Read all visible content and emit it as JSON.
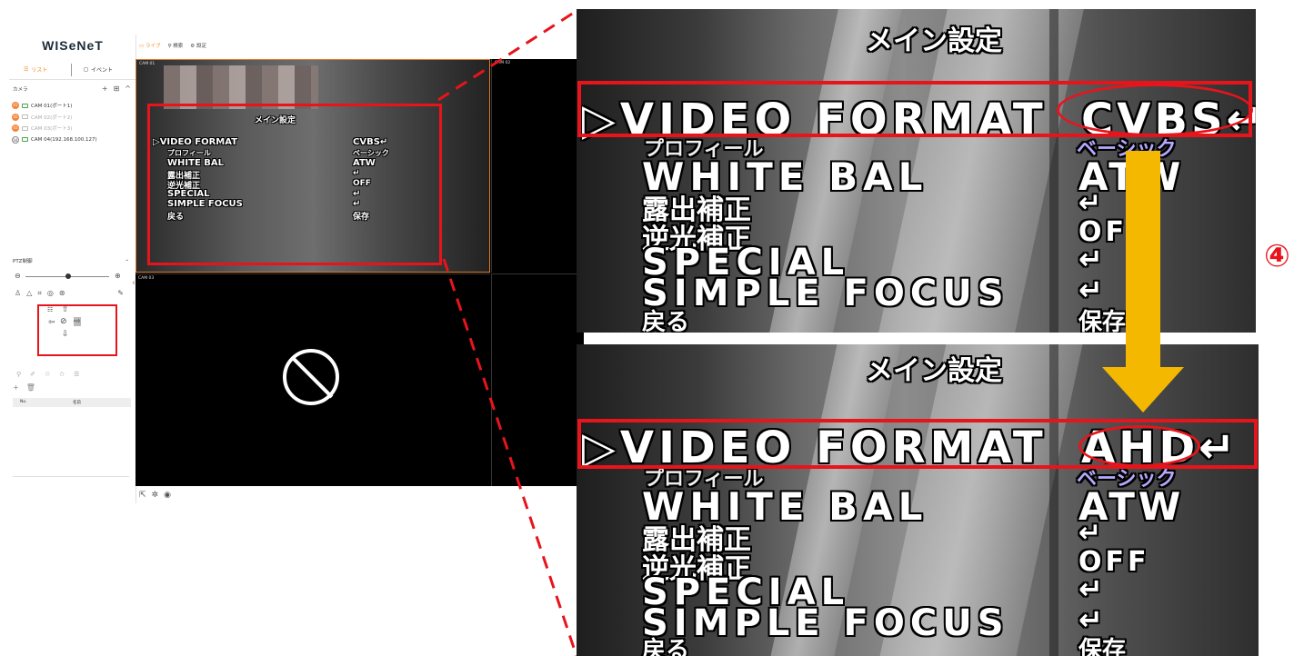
{
  "app": {
    "logo": "WISeNeT",
    "tabs": {
      "list": "リスト",
      "event": "イベント"
    },
    "topbar": {
      "live": "ライブ",
      "search": "検索",
      "settings": "設定"
    },
    "camera_section": {
      "title": "カメラ"
    },
    "cameras": [
      {
        "badge": "01",
        "label": "CAM 01(ポート1)",
        "active": true
      },
      {
        "badge": "02",
        "label": "CAM 02(ポート2)",
        "active": false
      },
      {
        "badge": "03",
        "label": "CAM 03(ポート3)",
        "active": true
      },
      {
        "badge": "04",
        "label": "CAM 04(192.168.100.127)",
        "active": true
      }
    ],
    "ptz": {
      "title": "PTZ制御"
    },
    "preset_table": {
      "col_no": "No.",
      "col_name": "名前"
    },
    "tiles": [
      {
        "label": "CAM 01"
      },
      {
        "label": "CAM 02"
      },
      {
        "label": "CAM 03"
      }
    ]
  },
  "osd_small": {
    "title": "メイン設定",
    "rows": [
      {
        "label": "▷VIDEO FORMAT",
        "value": "CVBS↵"
      },
      {
        "label": "プロフィール",
        "value": "ベーシック"
      },
      {
        "label": "WHITE BAL",
        "value": "ATW"
      },
      {
        "label": "露出補正",
        "value": "↵"
      },
      {
        "label": "逆光補正",
        "value": "OFF"
      },
      {
        "label": "SPECIAL",
        "value": "↵"
      },
      {
        "label": "SIMPLE FOCUS",
        "value": "↵"
      },
      {
        "label": "戻る",
        "value": "保存"
      }
    ]
  },
  "zoom_before": {
    "title": "メイン設定",
    "video_format_label": "▷VIDEO FORMAT",
    "video_format_value": "CVBS↵",
    "rows": [
      {
        "label": "プロフィール",
        "value": "ベーシック"
      },
      {
        "label": "WHITE BAL",
        "value": "ATW"
      },
      {
        "label": "露出補正",
        "value": "↵"
      },
      {
        "label": "逆光補正",
        "value": "OFF"
      },
      {
        "label": "SPECIAL",
        "value": "↵"
      },
      {
        "label": "SIMPLE FOCUS",
        "value": "↵"
      },
      {
        "label": "戻る",
        "value": "保存"
      }
    ]
  },
  "zoom_after": {
    "title": "メイン設定",
    "video_format_label": "▷VIDEO FORMAT",
    "video_format_value": "AHD↵",
    "rows": [
      {
        "label": "プロフィール",
        "value": "ベーシック"
      },
      {
        "label": "WHITE BAL",
        "value": "ATW"
      },
      {
        "label": "露出補正",
        "value": "↵"
      },
      {
        "label": "逆光補正",
        "value": "OFF"
      },
      {
        "label": "SPECIAL",
        "value": "↵"
      },
      {
        "label": "SIMPLE FOCUS",
        "value": "↵"
      },
      {
        "label": "戻る",
        "value": "保存"
      }
    ]
  },
  "step_marker": "④",
  "colors": {
    "highlight": "#e8141c",
    "arrow": "#f5b800",
    "accent": "#f08a1a"
  },
  "icons": {
    "list": "list-icon",
    "event": "bell-icon",
    "add": "plus-icon",
    "collapse": "chevron-up-icon",
    "zoom_out": "zoom-out-icon",
    "zoom_in": "zoom-in-icon",
    "prohibited": "no-signal-icon",
    "export": "export-icon",
    "rec": "rec-icon"
  }
}
